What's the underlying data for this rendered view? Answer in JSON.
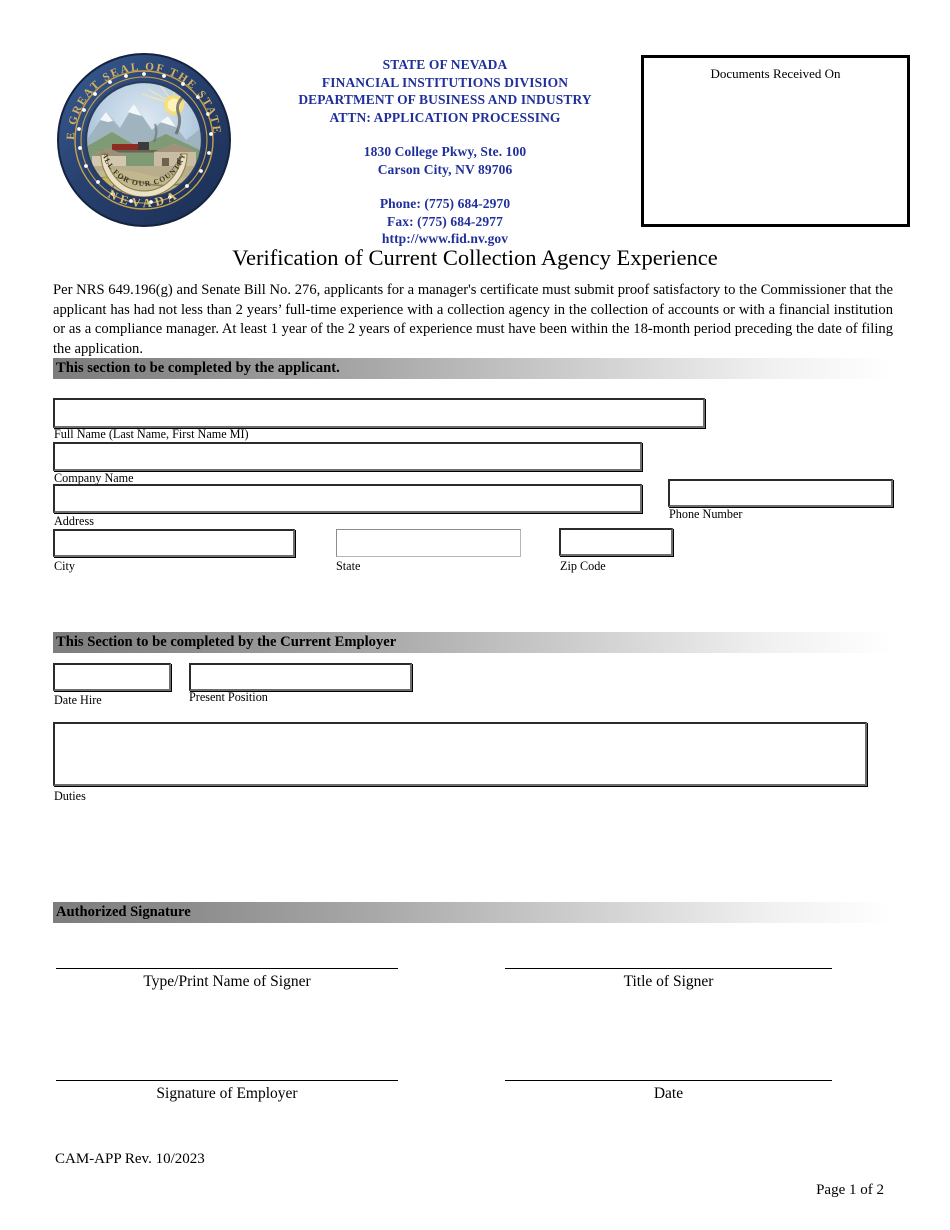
{
  "header": {
    "seal": {
      "outer_text": "THE GREAT SEAL OF THE STATE OF",
      "bottom_text": "NEVADA",
      "motto": "ALL FOR OUR COUNTRY",
      "ring_color": "#2c4a7c",
      "gold_color": "#c8a24a"
    },
    "agency": {
      "line1": "STATE OF NEVADA",
      "line2": "FINANCIAL INSTITUTIONS DIVISION",
      "line3": "DEPARTMENT OF BUSINESS AND INDUSTRY",
      "line4": "ATTN:  APPLICATION PROCESSING",
      "address1": "1830 College Pkwy, Ste. 100",
      "address2": "Carson City, NV  89706",
      "phone": "Phone:  (775) 684-2970",
      "fax": "Fax:  (775) 684-2977",
      "website": "http://www.fid.nv.gov",
      "text_color": "#20309a"
    },
    "received_box": {
      "label": "Documents Received On"
    }
  },
  "title": "Verification of Current Collection Agency Experience",
  "intro": "Per NRS 649.196(g) and Senate Bill No. 276, applicants for a manager's certificate must submit proof satisfactory to the Commissioner that the applicant has had not less than 2 years’ full-time experience with a collection agency in the collection of accounts or with a financial institution or as a compliance manager. At least 1 year of the 2 years of experience must have been within the 18-month period preceding the date of filing the application.",
  "sections": {
    "applicant": {
      "bar_label": "This section to be completed by the applicant.",
      "fields": [
        {
          "name": "full-name",
          "label": "Full Name (Last Name, First Name MI)",
          "value": ""
        },
        {
          "name": "company-name",
          "label": "Company Name",
          "value": ""
        },
        {
          "name": "address",
          "label": "Address",
          "value": ""
        },
        {
          "name": "phone-number",
          "label": "Phone Number",
          "value": ""
        },
        {
          "name": "city",
          "label": "City",
          "value": ""
        },
        {
          "name": "state",
          "label": "State",
          "value": ""
        },
        {
          "name": "zip-code",
          "label": "Zip Code",
          "value": ""
        }
      ]
    },
    "employer": {
      "bar_label": "This Section to be completed by the Current Employer",
      "fields": [
        {
          "name": "date-hire",
          "label": "Date Hire",
          "value": ""
        },
        {
          "name": "present-position",
          "label": "Present Position",
          "value": ""
        },
        {
          "name": "duties",
          "label": "Duties",
          "value": ""
        }
      ]
    },
    "signature": {
      "bar_label": "Authorized Signature",
      "lines": [
        {
          "name": "type-print-name-of-signer",
          "caption": "Type/Print Name of Signer"
        },
        {
          "name": "title-of-signer",
          "caption": "Title of Signer"
        },
        {
          "name": "signature-of-employer",
          "caption": "Signature of Employer"
        },
        {
          "name": "date",
          "caption": "Date"
        }
      ]
    }
  },
  "footer": {
    "revision": "CAM-APP Rev. 10/2023",
    "page_number": "Page 1 of 2"
  }
}
